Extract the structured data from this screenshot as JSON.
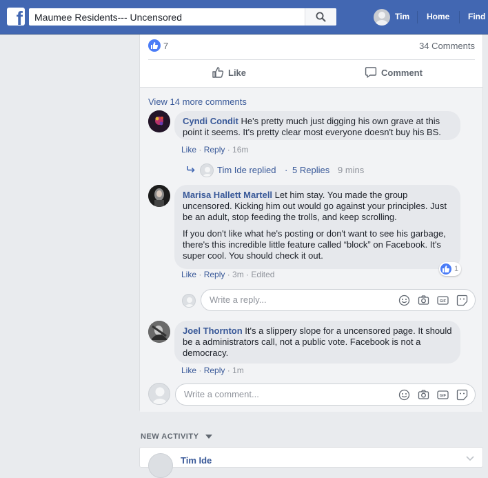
{
  "topbar": {
    "logo_letter": "f",
    "search_value": "Maumee Residents--- Uncensored",
    "user_name": "Tim",
    "nav_home": "Home",
    "nav_find": "Find"
  },
  "post": {
    "reaction_count": "7",
    "comment_count": "34 Comments",
    "like_label": "Like",
    "comment_label": "Comment"
  },
  "comments": {
    "view_more": "View 14 more comments",
    "items": [
      {
        "author": "Cyndi Condit",
        "text": " He's pretty much just digging his own grave at this point it seems. It's pretty clear most everyone doesn't buy his BS.",
        "like": "Like",
        "reply": "Reply",
        "time": "16m",
        "sep": " · "
      },
      {
        "author": "Marisa Hallett Martell",
        "text": " Let him stay. You made the group uncensored. Kicking him out would go against your principles. Just be an adult, stop feeding the trolls, and keep scrolling.",
        "text2": "If you don't like what he's posting or don't want to see his garbage, there's this incredible little feature called “block” on Facebook. It's super cool. You should check it out.",
        "reaction_count": "1",
        "like": "Like",
        "reply": "Reply",
        "time": "3m",
        "edited": "Edited",
        "sep": " · "
      },
      {
        "author": "Joel Thornton",
        "text": " It's a slippery slope for a uncensored page. It should be a administrators call, not a public vote. Facebook is not a democracy.",
        "like": "Like",
        "reply": "Reply",
        "time": "1m",
        "sep": " · "
      }
    ],
    "replied": {
      "name": "Tim Ide replied",
      "sep": " · ",
      "count": "5 Replies",
      "time": "9 mins"
    },
    "reply_placeholder": "Write a reply...",
    "comment_placeholder": "Write a comment..."
  },
  "activity": {
    "header": "NEW ACTIVITY",
    "name": "Tim Ide"
  },
  "colors": {
    "brand": "#4267b2",
    "link": "#385898",
    "like_blue": "#4a7cf7"
  },
  "icons": [
    "facebook-logo-icon",
    "search-icon",
    "like-icon",
    "comment-icon",
    "reply-arrow-icon",
    "emoji-icon",
    "camera-icon",
    "gif-icon",
    "sticker-icon",
    "chevron-down-icon"
  ]
}
